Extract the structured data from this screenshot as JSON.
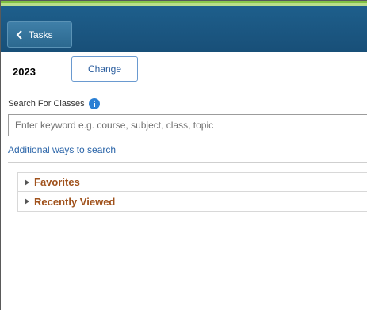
{
  "header": {
    "back_label": "Tasks",
    "accent_color": "#7fc043",
    "bar_color": "#1e5f8c"
  },
  "term": {
    "year": "2023",
    "change_label": "Change"
  },
  "search": {
    "label": "Search For Classes",
    "placeholder": "Enter keyword e.g. course, subject, class, topic",
    "value": "",
    "info_icon": "info-icon",
    "additional_link": "Additional ways to search"
  },
  "sections": [
    {
      "label": "Favorites",
      "expanded": false
    },
    {
      "label": "Recently Viewed",
      "expanded": false
    }
  ],
  "colors": {
    "link": "#2a64a8",
    "section_label": "#a0521c"
  }
}
